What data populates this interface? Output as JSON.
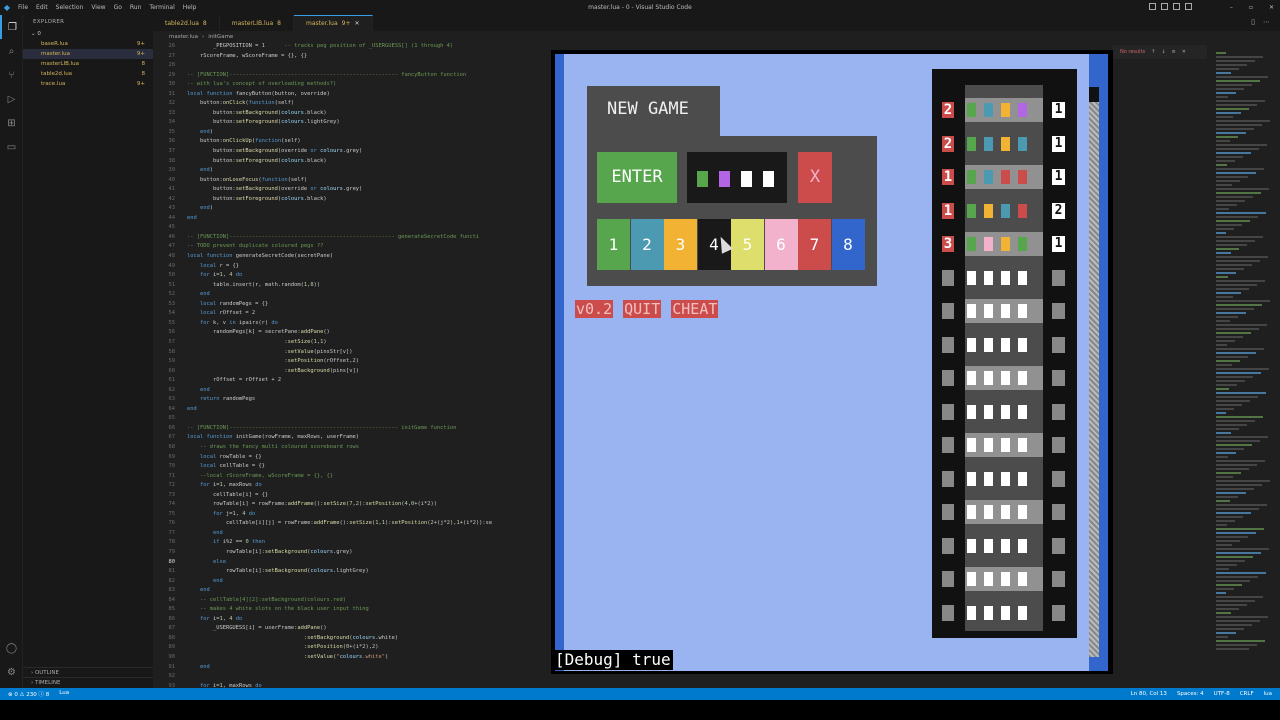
{
  "window": {
    "title": "master.lua - 0 - Visual Studio Code",
    "menu": [
      "File",
      "Edit",
      "Selection",
      "View",
      "Go",
      "Run",
      "Terminal",
      "Help"
    ]
  },
  "activity": [
    "files-icon",
    "search-icon",
    "source-control-icon",
    "run-debug-icon",
    "extensions-icon",
    "remote-icon",
    "account-icon",
    "settings-icon"
  ],
  "sidebar": {
    "header": "EXPLORER",
    "folder": "0",
    "files": [
      {
        "name": "baseR.lua",
        "badge": "9+"
      },
      {
        "name": "master.lua",
        "badge": "9+"
      },
      {
        "name": "masterLIB.lua",
        "badge": "8"
      },
      {
        "name": "table2d.lua",
        "badge": "8"
      },
      {
        "name": "trace.lua",
        "badge": "9+"
      }
    ],
    "outline": "OUTLINE",
    "timeline": "TIMELINE"
  },
  "tabs": [
    {
      "label": "table2d.lua",
      "badge": "8"
    },
    {
      "label": "masterLIB.lua",
      "badge": "8"
    },
    {
      "label": "master.lua",
      "badge": "9+"
    }
  ],
  "breadcrumb": [
    "master.lua",
    "initGame"
  ],
  "find": {
    "result": "No results"
  },
  "code": [
    {
      "n": "26",
      "t": "        _PEGPOSITION = 1      -- tracks peg position of _USERGUESS[] (1 through 4)"
    },
    {
      "n": "27",
      "t": "    rScoreFrame, wScoreFrame = {}, {}"
    },
    {
      "n": "28",
      "t": ""
    },
    {
      "n": "29",
      "t": "-- [FUNCTION]---------------------------------------------------- fancyButton function"
    },
    {
      "n": "30",
      "t": "-- with lua's concept of overloading methods?)"
    },
    {
      "n": "31",
      "t": "local function fancyButton(button, override)"
    },
    {
      "n": "32",
      "t": "    button:onClick(function(self)"
    },
    {
      "n": "33",
      "t": "        button:setBackground(colours.black)"
    },
    {
      "n": "34",
      "t": "        button:setForeground(colours.lightGrey)"
    },
    {
      "n": "35",
      "t": "    end)"
    },
    {
      "n": "36",
      "t": "    button:onClickUp(function(self)"
    },
    {
      "n": "37",
      "t": "        button:setBackground(override or colours.grey)"
    },
    {
      "n": "38",
      "t": "        button:setForeground(colours.black)"
    },
    {
      "n": "39",
      "t": "    end)"
    },
    {
      "n": "40",
      "t": "    button:onLoseFocus(function(self)"
    },
    {
      "n": "41",
      "t": "        button:setBackground(override or colours.grey)"
    },
    {
      "n": "42",
      "t": "        button:setForeground(colours.black)"
    },
    {
      "n": "43",
      "t": "    end)"
    },
    {
      "n": "44",
      "t": "end"
    },
    {
      "n": "45",
      "t": ""
    },
    {
      "n": "46",
      "t": "-- [FUNCTION]--------------------------------------------------- generateSecretCode functi"
    },
    {
      "n": "47",
      "t": "-- TODO prevent duplicate coloured pegs ??"
    },
    {
      "n": "48",
      "t": "local function generateSecretCode(secretPane)"
    },
    {
      "n": "49",
      "t": "    local r = {}"
    },
    {
      "n": "50",
      "t": "    for i=1, 4 do"
    },
    {
      "n": "51",
      "t": "        table.insert(r, math.random(1,8))"
    },
    {
      "n": "52",
      "t": "    end"
    },
    {
      "n": "53",
      "t": "    local randomPegs = {}"
    },
    {
      "n": "54",
      "t": "    local rOffset = 2"
    },
    {
      "n": "55",
      "t": "    for k, v in ipairs(r) do"
    },
    {
      "n": "56",
      "t": "        randomPegs[k] = secretPane:addPane()"
    },
    {
      "n": "57",
      "t": "                              :setSize(1,1)"
    },
    {
      "n": "58",
      "t": "                              :setValue(pinsStr[v])"
    },
    {
      "n": "59",
      "t": "                              :setPosition(rOffset,2)"
    },
    {
      "n": "60",
      "t": "                              :setBackground(pins[v])"
    },
    {
      "n": "61",
      "t": "        rOffset = rOffset + 2"
    },
    {
      "n": "62",
      "t": "    end"
    },
    {
      "n": "63",
      "t": "    return randomPegs"
    },
    {
      "n": "64",
      "t": "end"
    },
    {
      "n": "65",
      "t": ""
    },
    {
      "n": "66",
      "t": "-- [FUNCTION]---------------------------------------------------- initGame function"
    },
    {
      "n": "67",
      "t": "local function initGame(rowFrame, maxRows, userFrame)"
    },
    {
      "n": "68",
      "t": "    -- draws the fancy multi coloured scoreboard rows"
    },
    {
      "n": "69",
      "t": "    local rowTable = {}"
    },
    {
      "n": "70",
      "t": "    local cellTable = {}"
    },
    {
      "n": "71",
      "t": "    --local rScoreFrame, wScoreFrame = {}, {}"
    },
    {
      "n": "72",
      "t": "    for i=1, maxRows do"
    },
    {
      "n": "73",
      "t": "        cellTable[i] = {}"
    },
    {
      "n": "74",
      "t": "        rowTable[i] = rowFrame:addFrame():setSize(7,2):setPosition(4,0+(i*2))"
    },
    {
      "n": "75",
      "t": "        for j=1, 4 do"
    },
    {
      "n": "76",
      "t": "            cellTable[i][j] = rowFrame:addFrame():setSize(1,1):setPosition(2+(j*2),1+(i*2)):se"
    },
    {
      "n": "77",
      "t": "        end"
    },
    {
      "n": "78",
      "t": "        if i%2 == 0 then"
    },
    {
      "n": "79",
      "t": "            rowTable[i]:setBackground(colours.grey)"
    },
    {
      "n": "80",
      "t": "        else"
    },
    {
      "n": "81",
      "t": "            rowTable[i]:setBackground(colours.lightGrey)"
    },
    {
      "n": "82",
      "t": "        end"
    },
    {
      "n": "83",
      "t": "    end"
    },
    {
      "n": "84",
      "t": "    -- cellTable[4][2]:setBackground(colours.red)"
    },
    {
      "n": "85",
      "t": "    -- makes 4 white slots on the black user input thing"
    },
    {
      "n": "86",
      "t": "    for i=1, 4 do"
    },
    {
      "n": "87",
      "t": "        _USERGUESS[i] = userFrame:addPane()"
    },
    {
      "n": "88",
      "t": "                                    :setBackground(colours.white)"
    },
    {
      "n": "89",
      "t": "                                    :setPosition(0+(i*2),2)"
    },
    {
      "n": "90",
      "t": "                                    :setValue(\"colours.white\")"
    },
    {
      "n": "91",
      "t": "    end"
    },
    {
      "n": "92",
      "t": ""
    },
    {
      "n": "93",
      "t": "    for i=1, maxRows do"
    }
  ],
  "game": {
    "new_game": "NEW GAME",
    "enter": "ENTER",
    "clear": "X",
    "colors": [
      {
        "label": "1",
        "bg": "#57a64e"
      },
      {
        "label": "2",
        "bg": "#4c99b2"
      },
      {
        "label": "3",
        "bg": "#f2b233"
      },
      {
        "label": "4",
        "bg": "#191919"
      },
      {
        "label": "5",
        "bg": "#dede6c"
      },
      {
        "label": "6",
        "bg": "#f2b2cc"
      },
      {
        "label": "7",
        "bg": "#cc4c4c"
      },
      {
        "label": "8",
        "bg": "#3366cc"
      }
    ],
    "guess_pegs": [
      "#57a64e",
      "#b266e5",
      "#ffffff",
      "#ffffff"
    ],
    "version": "v0.2",
    "quit": "QUIT",
    "cheat": "CHEAT",
    "debug": "[Debug] true",
    "rows": [
      {
        "num": "2",
        "score": "1",
        "pegs": [
          "#57a64e",
          "#4c99b2",
          "#f2b233",
          "#b266e5"
        ]
      },
      {
        "num": "2",
        "score": "1",
        "pegs": [
          "#57a64e",
          "#4c99b2",
          "#f2b233",
          "#4c99b2"
        ]
      },
      {
        "num": "1",
        "score": "1",
        "pegs": [
          "#57a64e",
          "#4c99b2",
          "#cc4c4c",
          "#cc4c4c"
        ]
      },
      {
        "num": "1",
        "score": "2",
        "pegs": [
          "#57a64e",
          "#f2b233",
          "#4c99b2",
          "#cc4c4c"
        ]
      },
      {
        "num": "3",
        "score": "1",
        "pegs": [
          "#57a64e",
          "#f2b2cc",
          "#f2b233",
          "#57a64e"
        ]
      },
      {
        "num": "",
        "score": "",
        "pegs": [
          "#ffffff",
          "#ffffff",
          "#ffffff",
          "#ffffff"
        ]
      },
      {
        "num": "",
        "score": "",
        "pegs": [
          "#ffffff",
          "#ffffff",
          "#ffffff",
          "#ffffff"
        ]
      },
      {
        "num": "",
        "score": "",
        "pegs": [
          "#ffffff",
          "#ffffff",
          "#ffffff",
          "#ffffff"
        ]
      },
      {
        "num": "",
        "score": "",
        "pegs": [
          "#ffffff",
          "#ffffff",
          "#ffffff",
          "#ffffff"
        ]
      },
      {
        "num": "",
        "score": "",
        "pegs": [
          "#ffffff",
          "#ffffff",
          "#ffffff",
          "#ffffff"
        ]
      },
      {
        "num": "",
        "score": "",
        "pegs": [
          "#ffffff",
          "#ffffff",
          "#ffffff",
          "#ffffff"
        ]
      },
      {
        "num": "",
        "score": "",
        "pegs": [
          "#ffffff",
          "#ffffff",
          "#ffffff",
          "#ffffff"
        ]
      },
      {
        "num": "",
        "score": "",
        "pegs": [
          "#ffffff",
          "#ffffff",
          "#ffffff",
          "#ffffff"
        ]
      },
      {
        "num": "",
        "score": "",
        "pegs": [
          "#ffffff",
          "#ffffff",
          "#ffffff",
          "#ffffff"
        ]
      },
      {
        "num": "",
        "score": "",
        "pegs": [
          "#ffffff",
          "#ffffff",
          "#ffffff",
          "#ffffff"
        ]
      },
      {
        "num": "",
        "score": "",
        "pegs": [
          "#ffffff",
          "#ffffff",
          "#ffffff",
          "#ffffff"
        ]
      }
    ]
  },
  "status": {
    "left": [
      "⊗ 0 ⚠ 230 ⓘ 8",
      "Lua"
    ],
    "right": [
      "Ln 80, Col 13",
      "Spaces: 4",
      "UTF-8",
      "CRLF",
      "lua"
    ]
  }
}
